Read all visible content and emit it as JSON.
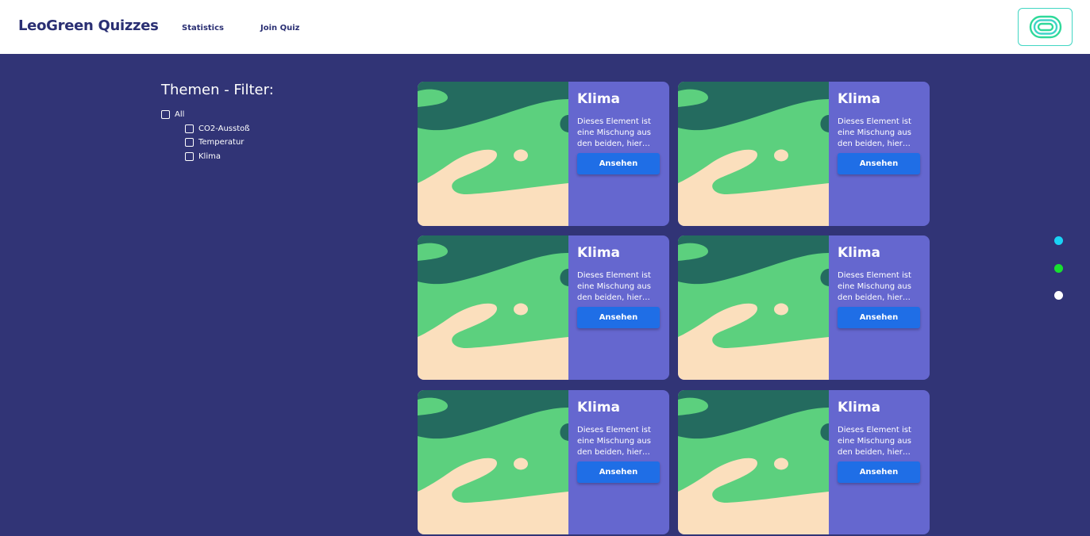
{
  "header": {
    "brand": "LeoGreen Quizzes",
    "nav": [
      "Statistics",
      "Join Quiz"
    ],
    "logo_icon": "leogreen-logo-icon"
  },
  "filter": {
    "title": "Themen - Filter:",
    "all_label": "All",
    "options": [
      "CO2-Ausstoß",
      "Temperatur",
      "Klima"
    ]
  },
  "cards": [
    {
      "title": "Klima",
      "description": "Dieses Element ist eine Mischung aus den beiden, hier…",
      "button": "Ansehen"
    },
    {
      "title": "Klima",
      "description": "Dieses Element ist eine Mischung aus den beiden, hier…",
      "button": "Ansehen"
    },
    {
      "title": "Klima",
      "description": "Dieses Element ist eine Mischung aus den beiden, hier…",
      "button": "Ansehen"
    },
    {
      "title": "Klima",
      "description": "Dieses Element ist eine Mischung aus den beiden, hier…",
      "button": "Ansehen"
    },
    {
      "title": "Klima",
      "description": "Dieses Element ist eine Mischung aus den beiden, hier…",
      "button": "Ansehen"
    },
    {
      "title": "Klima",
      "description": "Dieses Element ist eine Mischung aus den beiden, hier…",
      "button": "Ansehen"
    }
  ],
  "theme_dots": [
    {
      "color": "#19d3f5",
      "name": "cyan"
    },
    {
      "color": "#18e030",
      "name": "green"
    },
    {
      "color": "#ffffff",
      "name": "white"
    }
  ],
  "colors": {
    "background": "#313476",
    "card": "#6567cf",
    "button": "#1f6ee6",
    "brand": "#2a2f73"
  }
}
